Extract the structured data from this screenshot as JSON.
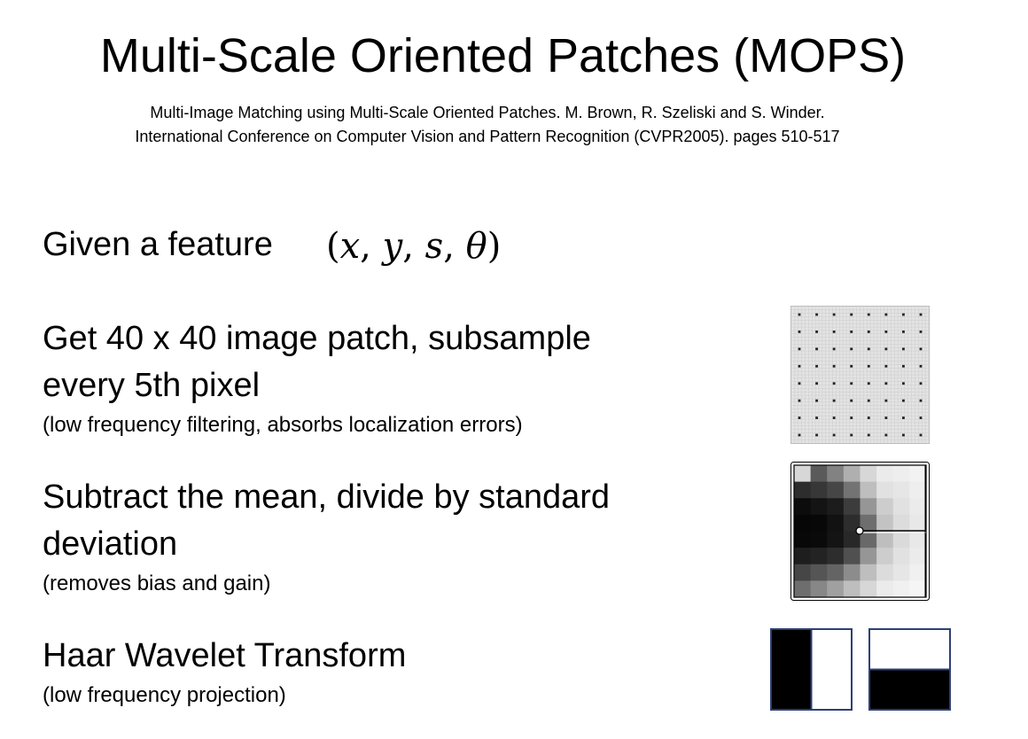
{
  "slide": {
    "title": "Multi-Scale Oriented Patches (MOPS)",
    "citation": {
      "line1": "Multi-Image Matching using Multi-Scale Oriented Patches. M. Brown, R. Szeliski and S. Winder.",
      "line2": "International Conference on Computer Vision and Pattern Recognition (CVPR2005). pages 510-517"
    },
    "feature": {
      "label": "Given a feature",
      "open_paren": "(",
      "x": "x",
      "y": "y",
      "s": "s",
      "theta": "θ",
      "comma": ",",
      "close_paren": ")"
    },
    "patch": {
      "line1": "Get 40 x 40 image patch, subsample",
      "line2": "every 5th pixel",
      "note": "(low frequency filtering, absorbs localization errors)"
    },
    "normalize": {
      "line1": "Subtract the mean, divide by standard",
      "line2": "deviation",
      "note": "(removes bias and gain)"
    },
    "haar": {
      "heading": "Haar Wavelet Transform",
      "note": "(low frequency projection)"
    }
  },
  "figures": {
    "patch_grid": {
      "sample_rows": 8,
      "sample_cols": 8,
      "background": "#e3e3e3",
      "grid_line": "#c6c6c6",
      "dot": "#222222"
    },
    "normalized_patch": {
      "gray_levels": [
        [
          215,
          90,
          130,
          175,
          215,
          235,
          238,
          242
        ],
        [
          45,
          55,
          70,
          115,
          190,
          225,
          230,
          238
        ],
        [
          12,
          20,
          28,
          60,
          150,
          205,
          225,
          235
        ],
        [
          6,
          8,
          18,
          45,
          110,
          195,
          220,
          232
        ],
        [
          8,
          10,
          20,
          40,
          105,
          190,
          218,
          232
        ],
        [
          30,
          35,
          45,
          80,
          150,
          205,
          225,
          235
        ],
        [
          70,
          85,
          100,
          140,
          190,
          220,
          230,
          240
        ],
        [
          110,
          135,
          160,
          190,
          215,
          235,
          240,
          245
        ]
      ],
      "border": "#000000"
    },
    "haar_colors": {
      "black": "#000000",
      "white": "#ffffff",
      "border": "#2e3f77"
    }
  }
}
